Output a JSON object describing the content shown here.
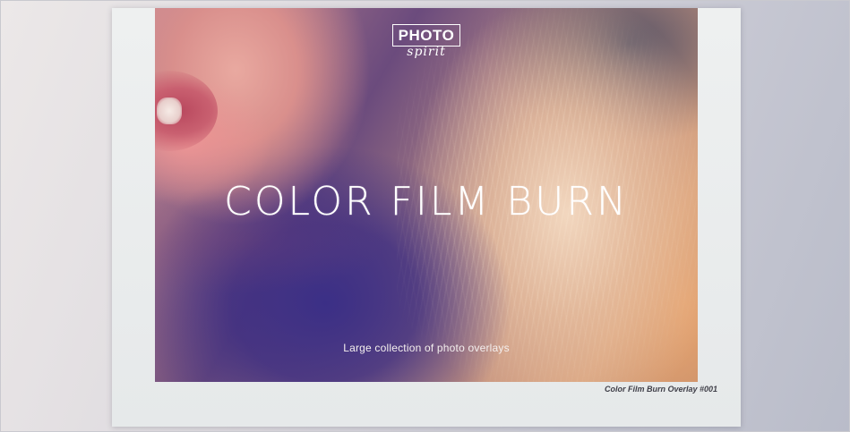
{
  "logo": {
    "line1": "PHOTO",
    "line2": "spirit"
  },
  "headline": "COLOR FILM BURN",
  "tagline": "Large collection of photo overlays",
  "caption": "Color Film Burn Overlay #001"
}
